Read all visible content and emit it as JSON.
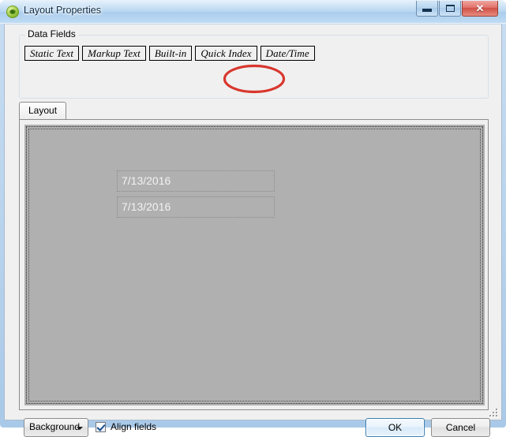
{
  "window": {
    "title": "Layout Properties",
    "icon": "green-orb-icon",
    "caption_buttons": [
      {
        "name": "minimize",
        "glyph": "minimize-icon",
        "tooltip": "Minimize"
      },
      {
        "name": "maximize",
        "glyph": "maximize-icon",
        "tooltip": "Maximize"
      },
      {
        "name": "close",
        "glyph": "✕",
        "tooltip": "Close"
      }
    ]
  },
  "data_fields": {
    "group_label": "Data Fields",
    "buttons": [
      {
        "label": "Static Text"
      },
      {
        "label": "Markup Text"
      },
      {
        "label": "Built-in"
      },
      {
        "label": "Quick Index"
      },
      {
        "label": "Date/Time"
      }
    ],
    "highlighted_button": "Date/Time",
    "annotation": {
      "shape": "ellipse",
      "color": "#d8372e",
      "target": "Date/Time"
    }
  },
  "tabs": [
    {
      "label": "Layout",
      "selected": true
    }
  ],
  "canvas": {
    "background_color": "#b0b0b0",
    "fields": [
      {
        "text": "7/13/2016",
        "type": "date-time"
      },
      {
        "text": "7/13/2016",
        "type": "date-time"
      }
    ]
  },
  "footer": {
    "background_label": "Background",
    "align_fields_label": "Align fields",
    "align_fields_checked": true,
    "ok_label": "OK",
    "cancel_label": "Cancel"
  }
}
